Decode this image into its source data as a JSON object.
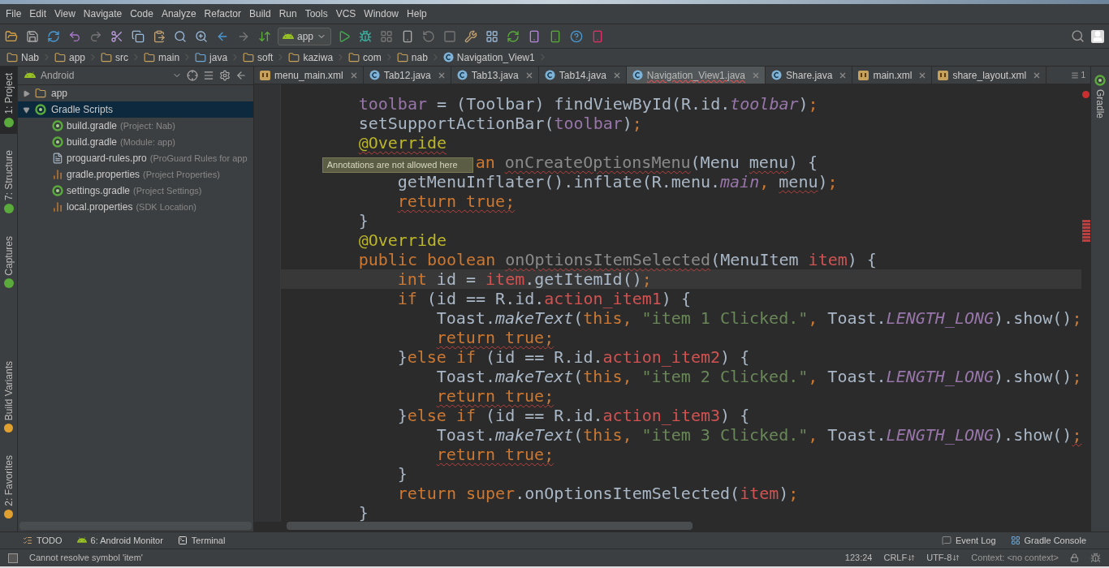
{
  "menu": [
    "File",
    "Edit",
    "View",
    "Navigate",
    "Code",
    "Analyze",
    "Refactor",
    "Build",
    "Run",
    "Tools",
    "VCS",
    "Window",
    "Help"
  ],
  "run_config": "app",
  "breadcrumb": [
    {
      "label": "Nab",
      "kind": "module"
    },
    {
      "label": "app",
      "kind": "module"
    },
    {
      "label": "src",
      "kind": "folder"
    },
    {
      "label": "main",
      "kind": "folder"
    },
    {
      "label": "java",
      "kind": "source"
    },
    {
      "label": "soft",
      "kind": "package"
    },
    {
      "label": "kaziwa",
      "kind": "package"
    },
    {
      "label": "com",
      "kind": "package"
    },
    {
      "label": "nab",
      "kind": "package"
    },
    {
      "label": "Navigation_View1",
      "kind": "class"
    }
  ],
  "left_stripe_top": [
    {
      "label": "1: Project",
      "selected": true
    },
    {
      "label": "7: Structure",
      "selected": false
    },
    {
      "label": "Captures",
      "selected": false
    }
  ],
  "left_stripe_bottom": [
    {
      "label": "Build Variants",
      "selected": false
    },
    {
      "label": "2: Favorites",
      "selected": false
    }
  ],
  "project_panel": {
    "view": "Android",
    "tree": [
      {
        "label": "app",
        "kind": "module",
        "expanded": false,
        "selected": false
      },
      {
        "label": "Gradle Scripts",
        "kind": "gradle",
        "expanded": true,
        "selected": true,
        "children": [
          {
            "label": "build.gradle",
            "note": "(Project: Nab)",
            "kind": "gradle",
            "selected": false
          },
          {
            "label": "build.gradle",
            "note": "(Module: app)",
            "kind": "gradle",
            "selected": false
          },
          {
            "label": "proguard-rules.pro",
            "note": "(ProGuard Rules for app",
            "kind": "text",
            "selected": false
          },
          {
            "label": "gradle.properties",
            "note": "(Project Properties)",
            "kind": "properties",
            "selected": false
          },
          {
            "label": "settings.gradle",
            "note": "(Project Settings)",
            "kind": "gradle",
            "selected": false
          },
          {
            "label": "local.properties",
            "note": "(SDK Location)",
            "kind": "properties",
            "selected": false
          }
        ]
      }
    ]
  },
  "tabs": [
    {
      "label": "menu_main.xml",
      "kind": "xml",
      "selected": false
    },
    {
      "label": "Tab12.java",
      "kind": "class",
      "selected": false
    },
    {
      "label": "Tab13.java",
      "kind": "class",
      "selected": false
    },
    {
      "label": "Tab14.java",
      "kind": "class",
      "selected": false
    },
    {
      "label": "Navigation_View1.java",
      "kind": "class",
      "selected": true
    },
    {
      "label": "Share.java",
      "kind": "class",
      "selected": false
    },
    {
      "label": "main.xml",
      "kind": "xml",
      "selected": false
    },
    {
      "label": "share_layout.xml",
      "kind": "xml",
      "selected": false
    }
  ],
  "tab_overflow": "1",
  "editor": {
    "lines": [
      {
        "tokens": [
          {
            "text": "toolbar",
            "kind": "field"
          },
          {
            "text": " = (Toolbar) findViewById(R.id.",
            "kind": "plain"
          },
          {
            "text": "toolbar",
            "kind": "static"
          },
          {
            "text": ")",
            "kind": "plain"
          },
          {
            "text": ";",
            "kind": "kw"
          }
        ]
      },
      {
        "tokens": [
          {
            "text": "setSupportActionBar(",
            "kind": "plain"
          },
          {
            "text": "toolbar",
            "kind": "field"
          },
          {
            "text": ")",
            "kind": "plain"
          },
          {
            "text": ";",
            "kind": "kw"
          }
        ]
      },
      {
        "tokens": [
          {
            "text": "@Override",
            "kind": "ann",
            "err": true
          }
        ]
      },
      {
        "covered": true,
        "tokens": [
          {
            "text": "an ",
            "kind": "kw"
          },
          {
            "text": "onCreateOptionsMenu",
            "kind": "grey",
            "err": true
          },
          {
            "text": "(Menu ",
            "kind": "plain"
          },
          {
            "text": "menu",
            "kind": "plain",
            "err": true
          },
          {
            "text": ") {",
            "kind": "plain"
          }
        ],
        "children": [
          {
            "tokens": [
              {
                "text": "getMenuInflater().inflate(R.menu.",
                "kind": "plain"
              },
              {
                "text": "main",
                "kind": "static"
              },
              {
                "text": ", ",
                "kind": "kw"
              },
              {
                "text": "menu",
                "kind": "plain",
                "err": true
              },
              {
                "text": ")",
                "kind": "plain"
              },
              {
                "text": ";",
                "kind": "kw"
              }
            ]
          },
          {
            "tokens": [
              {
                "text": "return true",
                "kind": "kw",
                "err": true
              },
              {
                "text": ";",
                "kind": "kw",
                "err": true
              }
            ]
          }
        ]
      },
      {
        "tokens": [
          {
            "text": "}",
            "kind": "plain"
          }
        ]
      },
      {
        "tokens": [
          {
            "text": "@Override",
            "kind": "ann"
          }
        ]
      },
      {
        "tokens": [
          {
            "text": "public boolean ",
            "kind": "kw"
          },
          {
            "text": "onOptionsItemSelected",
            "kind": "grey",
            "err": true
          },
          {
            "text": "(MenuItem ",
            "kind": "plain"
          },
          {
            "text": "item",
            "kind": "bad"
          },
          {
            "text": ") {",
            "kind": "plain"
          }
        ],
        "children": [
          {
            "current": true,
            "tokens": [
              {
                "text": "int",
                "kind": "kw"
              },
              {
                "text": " id = ",
                "kind": "plain"
              },
              {
                "text": "item",
                "kind": "bad"
              },
              {
                "text": ".getItemId()",
                "kind": "plain"
              },
              {
                "text": ";",
                "kind": "kw"
              }
            ]
          },
          {
            "tokens": [
              {
                "text": "if",
                "kind": "kw"
              },
              {
                "text": " (id == R.id.",
                "kind": "plain"
              },
              {
                "text": "action_item1",
                "kind": "bad"
              },
              {
                "text": ") {",
                "kind": "plain"
              }
            ],
            "children": [
              {
                "tokens": [
                  {
                    "text": "Toast.",
                    "kind": "plain"
                  },
                  {
                    "text": "makeText",
                    "kind": "smethod"
                  },
                  {
                    "text": "(",
                    "kind": "plain"
                  },
                  {
                    "text": "this",
                    "kind": "kw"
                  },
                  {
                    "text": ", ",
                    "kind": "kw"
                  },
                  {
                    "text": "\"item 1 Clicked.\"",
                    "kind": "str"
                  },
                  {
                    "text": ",",
                    "kind": "kw"
                  },
                  {
                    "text": " Toast.",
                    "kind": "plain"
                  },
                  {
                    "text": "LENGTH_LONG",
                    "kind": "static"
                  },
                  {
                    "text": ").show()",
                    "kind": "plain"
                  },
                  {
                    "text": ";",
                    "kind": "kw"
                  }
                ]
              },
              {
                "tokens": [
                  {
                    "text": "return true",
                    "kind": "kw",
                    "err": true
                  },
                  {
                    "text": ";",
                    "kind": "kw",
                    "err": true
                  }
                ]
              }
            ]
          },
          {
            "tokens": [
              {
                "text": "}",
                "kind": "plain"
              },
              {
                "text": "else if",
                "kind": "kw"
              },
              {
                "text": " (id == R.id.",
                "kind": "plain"
              },
              {
                "text": "action_item2",
                "kind": "bad"
              },
              {
                "text": ") {",
                "kind": "plain"
              }
            ],
            "children": [
              {
                "tokens": [
                  {
                    "text": "Toast.",
                    "kind": "plain"
                  },
                  {
                    "text": "makeText",
                    "kind": "smethod"
                  },
                  {
                    "text": "(",
                    "kind": "plain"
                  },
                  {
                    "text": "this",
                    "kind": "kw"
                  },
                  {
                    "text": ", ",
                    "kind": "kw"
                  },
                  {
                    "text": "\"item 2 Clicked.\"",
                    "kind": "str"
                  },
                  {
                    "text": ",",
                    "kind": "kw"
                  },
                  {
                    "text": " Toast.",
                    "kind": "plain"
                  },
                  {
                    "text": "LENGTH_LONG",
                    "kind": "static"
                  },
                  {
                    "text": ").show()",
                    "kind": "plain"
                  },
                  {
                    "text": ";",
                    "kind": "kw"
                  }
                ]
              },
              {
                "tokens": [
                  {
                    "text": "return true",
                    "kind": "kw",
                    "err": true
                  },
                  {
                    "text": ";",
                    "kind": "kw",
                    "err": true
                  }
                ]
              }
            ]
          },
          {
            "tokens": [
              {
                "text": "}",
                "kind": "plain"
              },
              {
                "text": "else if",
                "kind": "kw"
              },
              {
                "text": " (id == R.id.",
                "kind": "plain"
              },
              {
                "text": "action_item3",
                "kind": "bad"
              },
              {
                "text": ") {",
                "kind": "plain"
              }
            ],
            "children": [
              {
                "tokens": [
                  {
                    "text": "Toast.",
                    "kind": "plain"
                  },
                  {
                    "text": "makeText",
                    "kind": "smethod"
                  },
                  {
                    "text": "(",
                    "kind": "plain"
                  },
                  {
                    "text": "this",
                    "kind": "kw"
                  },
                  {
                    "text": ", ",
                    "kind": "kw"
                  },
                  {
                    "text": "\"item 3 Clicked.\"",
                    "kind": "str"
                  },
                  {
                    "text": ",",
                    "kind": "kw"
                  },
                  {
                    "text": " Toast.",
                    "kind": "plain"
                  },
                  {
                    "text": "LENGTH_LONG",
                    "kind": "static"
                  },
                  {
                    "text": ").show()",
                    "kind": "plain"
                  },
                  {
                    "text": ";",
                    "kind": "kw",
                    "err": true
                  }
                ]
              },
              {
                "tokens": [
                  {
                    "text": "return true",
                    "kind": "kw",
                    "err": true
                  },
                  {
                    "text": ";",
                    "kind": "kw",
                    "err": true
                  }
                ]
              }
            ]
          },
          {
            "tokens": [
              {
                "text": "}",
                "kind": "plain"
              }
            ]
          },
          {
            "tokens": [
              {
                "text": "return super",
                "kind": "kw"
              },
              {
                "text": ".onOptionsItemSelected(",
                "kind": "plain"
              },
              {
                "text": "item",
                "kind": "bad"
              },
              {
                "text": ")",
                "kind": "plain"
              },
              {
                "text": ";",
                "kind": "kw"
              }
            ]
          }
        ]
      },
      {
        "tokens": [
          {
            "text": "}",
            "kind": "plain"
          }
        ]
      }
    ],
    "tooltip": "Annotations are not allowed here"
  },
  "right_stripe": "Gradle",
  "bottom_tools_left": [
    {
      "label": "TODO",
      "kind": "todo"
    },
    {
      "label": "6: Android Monitor",
      "kind": "android"
    },
    {
      "label": "Terminal",
      "kind": "terminal"
    }
  ],
  "bottom_tools_right": [
    {
      "label": "Event Log",
      "kind": "log"
    },
    {
      "label": "Gradle Console",
      "kind": "console"
    }
  ],
  "status": {
    "message": "Cannot resolve symbol 'item'",
    "position": "123:24",
    "line_separator": "CRLF",
    "encoding": "UTF-8",
    "context": "Context: <no context>"
  }
}
